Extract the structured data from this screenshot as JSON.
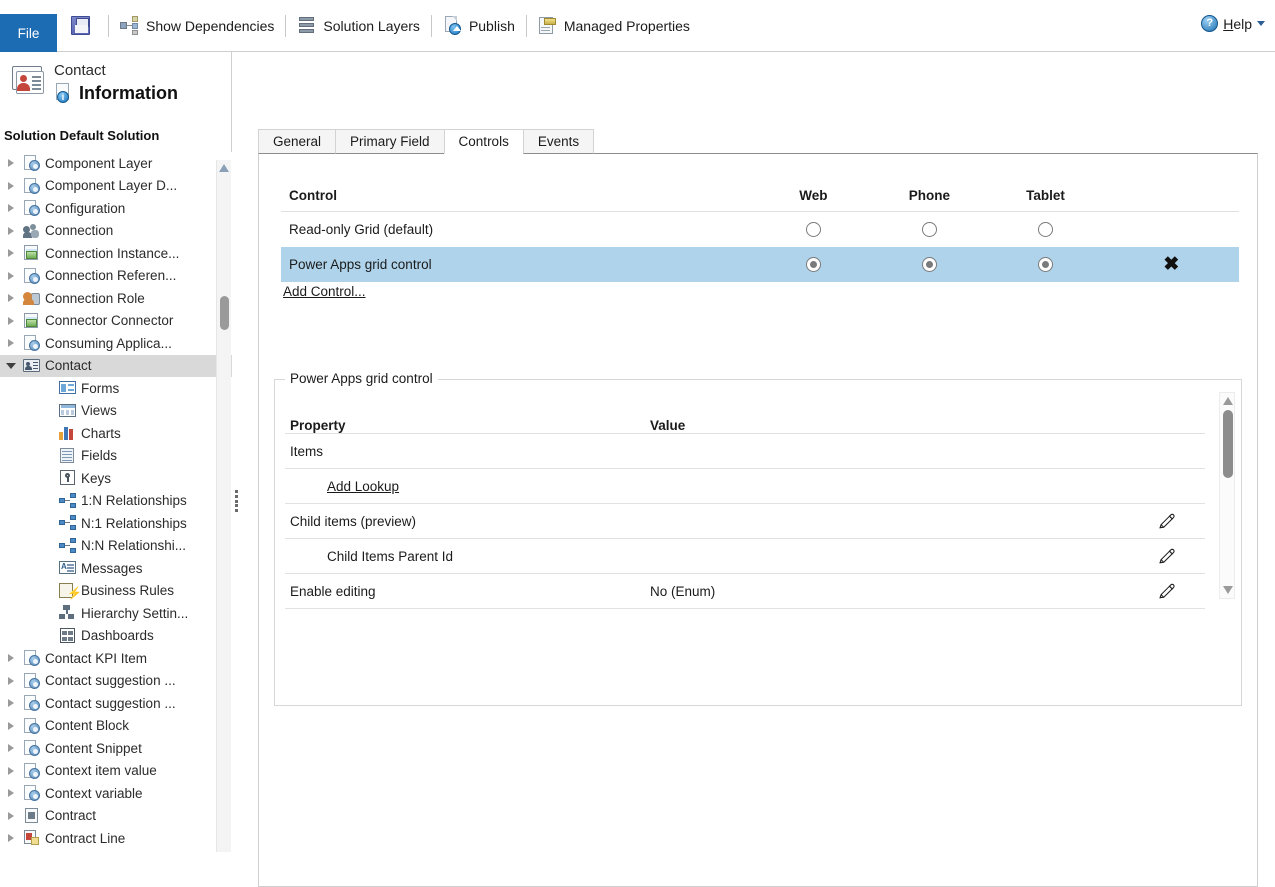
{
  "toolbar": {
    "file_label": "File",
    "items": [
      {
        "label": "",
        "icon": "save-icon"
      },
      {
        "label": "Show Dependencies",
        "icon": "dependencies-icon"
      },
      {
        "label": "Solution Layers",
        "icon": "layers-icon"
      },
      {
        "label": "Publish",
        "icon": "publish-icon"
      },
      {
        "label": "Managed Properties",
        "icon": "managed-properties-icon"
      }
    ],
    "help_prefix": "H",
    "help_rest": "elp"
  },
  "entity_header": {
    "entity": "Contact",
    "title": "Information",
    "solution_label": "Solution",
    "solution_name": "Default Solution"
  },
  "tree": {
    "items": [
      {
        "label": "Component Layer",
        "icon": "entity-icon",
        "indent": 0,
        "expandable": true,
        "expanded": false,
        "selected": false
      },
      {
        "label": "Component Layer D...",
        "icon": "entity-icon",
        "indent": 0,
        "expandable": true,
        "expanded": false,
        "selected": false
      },
      {
        "label": "Configuration",
        "icon": "entity-icon",
        "indent": 0,
        "expandable": true,
        "expanded": false,
        "selected": false
      },
      {
        "label": "Connection",
        "icon": "people-icon",
        "indent": 0,
        "expandable": true,
        "expanded": false,
        "selected": false
      },
      {
        "label": "Connection Instance...",
        "icon": "image-icon",
        "indent": 0,
        "expandable": true,
        "expanded": false,
        "selected": false
      },
      {
        "label": "Connection Referen...",
        "icon": "entity-icon",
        "indent": 0,
        "expandable": true,
        "expanded": false,
        "selected": false
      },
      {
        "label": "Connection Role",
        "icon": "role-icon",
        "indent": 0,
        "expandable": true,
        "expanded": false,
        "selected": false
      },
      {
        "label": "Connector Connector",
        "icon": "image-icon",
        "indent": 0,
        "expandable": true,
        "expanded": false,
        "selected": false
      },
      {
        "label": "Consuming Applica...",
        "icon": "entity-icon",
        "indent": 0,
        "expandable": true,
        "expanded": false,
        "selected": false
      },
      {
        "label": "Contact",
        "icon": "contact-icon",
        "indent": 0,
        "expandable": true,
        "expanded": true,
        "selected": true
      },
      {
        "label": "Forms",
        "icon": "forms-icon",
        "indent": 1,
        "expandable": false,
        "expanded": false,
        "selected": false
      },
      {
        "label": "Views",
        "icon": "views-icon",
        "indent": 1,
        "expandable": false,
        "expanded": false,
        "selected": false
      },
      {
        "label": "Charts",
        "icon": "charts-icon",
        "indent": 1,
        "expandable": false,
        "expanded": false,
        "selected": false
      },
      {
        "label": "Fields",
        "icon": "fields-icon",
        "indent": 1,
        "expandable": false,
        "expanded": false,
        "selected": false
      },
      {
        "label": "Keys",
        "icon": "keys-icon",
        "indent": 1,
        "expandable": false,
        "expanded": false,
        "selected": false
      },
      {
        "label": "1:N Relationships",
        "icon": "relationship-icon",
        "indent": 1,
        "expandable": false,
        "expanded": false,
        "selected": false
      },
      {
        "label": "N:1 Relationships",
        "icon": "relationship-icon",
        "indent": 1,
        "expandable": false,
        "expanded": false,
        "selected": false
      },
      {
        "label": "N:N Relationshi...",
        "icon": "relationship-icon",
        "indent": 1,
        "expandable": false,
        "expanded": false,
        "selected": false
      },
      {
        "label": "Messages",
        "icon": "messages-icon",
        "indent": 1,
        "expandable": false,
        "expanded": false,
        "selected": false
      },
      {
        "label": "Business Rules",
        "icon": "business-rules-icon",
        "indent": 1,
        "expandable": false,
        "expanded": false,
        "selected": false
      },
      {
        "label": "Hierarchy Settin...",
        "icon": "hierarchy-icon",
        "indent": 1,
        "expandable": false,
        "expanded": false,
        "selected": false
      },
      {
        "label": "Dashboards",
        "icon": "dashboards-icon",
        "indent": 1,
        "expandable": false,
        "expanded": false,
        "selected": false
      },
      {
        "label": "Contact KPI Item",
        "icon": "entity-icon",
        "indent": 0,
        "expandable": true,
        "expanded": false,
        "selected": false
      },
      {
        "label": "Contact suggestion ...",
        "icon": "entity-icon",
        "indent": 0,
        "expandable": true,
        "expanded": false,
        "selected": false
      },
      {
        "label": "Contact suggestion ...",
        "icon": "entity-icon",
        "indent": 0,
        "expandable": true,
        "expanded": false,
        "selected": false
      },
      {
        "label": "Content Block",
        "icon": "entity-icon",
        "indent": 0,
        "expandable": true,
        "expanded": false,
        "selected": false
      },
      {
        "label": "Content Snippet",
        "icon": "entity-icon",
        "indent": 0,
        "expandable": true,
        "expanded": false,
        "selected": false
      },
      {
        "label": "Context item value",
        "icon": "entity-icon",
        "indent": 0,
        "expandable": true,
        "expanded": false,
        "selected": false
      },
      {
        "label": "Context variable",
        "icon": "entity-icon",
        "indent": 0,
        "expandable": true,
        "expanded": false,
        "selected": false
      },
      {
        "label": "Contract",
        "icon": "document-icon",
        "indent": 0,
        "expandable": true,
        "expanded": false,
        "selected": false
      },
      {
        "label": "Contract Line",
        "icon": "contract-line-icon",
        "indent": 0,
        "expandable": true,
        "expanded": false,
        "selected": false
      }
    ]
  },
  "tabs": [
    {
      "label": "General",
      "active": false
    },
    {
      "label": "Primary Field",
      "active": false
    },
    {
      "label": "Controls",
      "active": true
    },
    {
      "label": "Events",
      "active": false
    }
  ],
  "controls_table": {
    "headers": {
      "control": "Control",
      "web": "Web",
      "phone": "Phone",
      "tablet": "Tablet"
    },
    "rows": [
      {
        "name": "Read-only Grid (default)",
        "web": false,
        "phone": false,
        "tablet": false,
        "selected": false,
        "removable": false
      },
      {
        "name": "Power Apps grid control",
        "web": true,
        "phone": true,
        "tablet": true,
        "selected": true,
        "removable": true
      }
    ],
    "add_control_label": "Add Control..."
  },
  "properties_panel": {
    "legend": "Power Apps grid control",
    "headers": {
      "property": "Property",
      "value": "Value"
    },
    "rows": [
      {
        "name": "Items",
        "value": "",
        "indent": 0,
        "link": false,
        "edit": false
      },
      {
        "name": "Add Lookup",
        "value": "",
        "indent": 1,
        "link": true,
        "edit": false
      },
      {
        "name": "Child items (preview)",
        "value": "",
        "indent": 0,
        "link": false,
        "edit": true
      },
      {
        "name": "Child Items Parent Id",
        "value": "",
        "indent": 1,
        "link": false,
        "edit": true
      },
      {
        "name": "Enable editing",
        "value": "No (Enum)",
        "indent": 0,
        "link": false,
        "edit": true
      }
    ]
  },
  "colors": {
    "file_button": "#1c6cb4",
    "row_selected": "#aed3ea",
    "tree_selected": "#d9d9d9"
  }
}
